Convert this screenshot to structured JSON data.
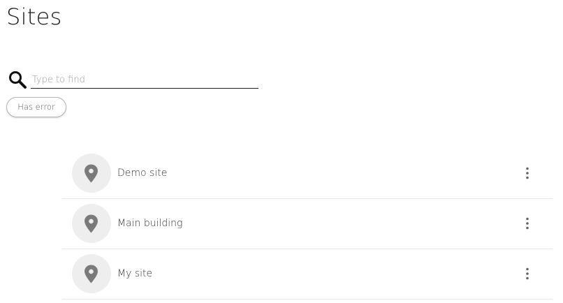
{
  "page": {
    "title": "Sites"
  },
  "search": {
    "icon": "search-icon",
    "placeholder": "Type to find",
    "value": ""
  },
  "filters": {
    "has_error_label": "Has error"
  },
  "sites": {
    "items": [
      {
        "name": "Demo site",
        "icon": "map-pin-icon",
        "menu_icon": "more-vertical-icon"
      },
      {
        "name": "Main building",
        "icon": "map-pin-icon",
        "menu_icon": "more-vertical-icon"
      },
      {
        "name": "My site",
        "icon": "map-pin-icon",
        "menu_icon": "more-vertical-icon"
      }
    ]
  },
  "colors": {
    "avatar_background": "#eeeeee",
    "pin_icon": "#7a7a7a",
    "divider": "#e6e6e6",
    "chip_border": "#b5b5b5"
  }
}
